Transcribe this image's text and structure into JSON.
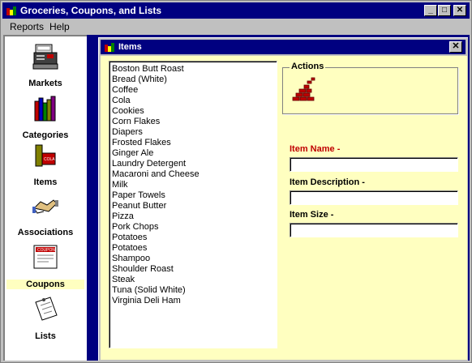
{
  "window": {
    "title": "Groceries, Coupons, and Lists"
  },
  "menu": [
    "Reports",
    "Help"
  ],
  "nav": [
    {
      "label": "Markets"
    },
    {
      "label": "Categories"
    },
    {
      "label": "Items"
    },
    {
      "label": "Associations"
    },
    {
      "label": "Coupons",
      "selected": true
    },
    {
      "label": "Lists"
    }
  ],
  "child": {
    "title": "Items",
    "items": [
      "Boston Butt Roast",
      "Bread (White)",
      "Coffee",
      "Cola",
      "Cookies",
      "Corn Flakes",
      "Diapers",
      "Frosted Flakes",
      "Ginger Ale",
      "Laundry Detergent",
      "Macaroni and Cheese",
      "Milk",
      "Paper Towels",
      "Peanut Butter",
      "Pizza",
      "Pork Chops",
      "Potatoes",
      "Potatoes",
      "Shampoo",
      "Shoulder Roast",
      "Steak",
      "Tuna (Solid White)",
      "Virginia Deli Ham"
    ],
    "actions_label": "Actions",
    "fields": {
      "name_label": "Item Name -",
      "name_value": "",
      "description_label": "Item Description -",
      "description_value": "",
      "size_label": "Item Size -",
      "size_value": ""
    }
  },
  "colors": {
    "title_bar": "#000080",
    "panel_bg": "#ffffc0",
    "required": "#c00000"
  }
}
